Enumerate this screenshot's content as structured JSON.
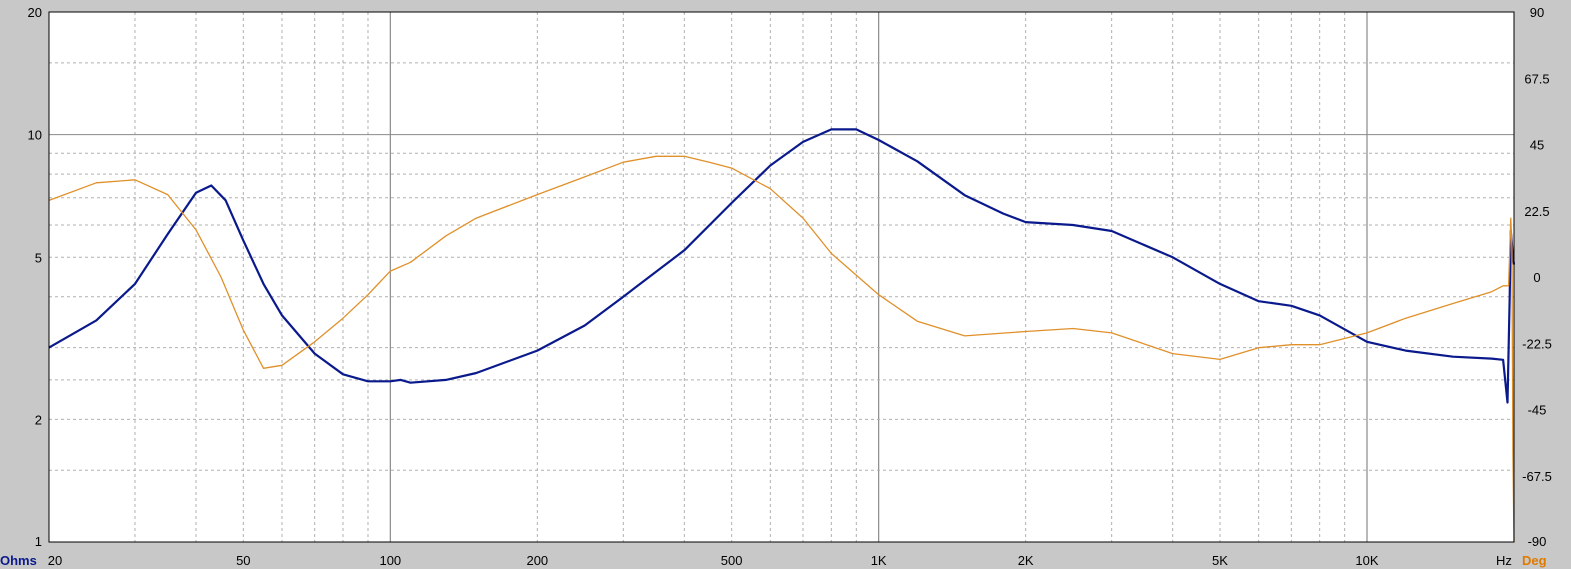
{
  "chart_data": {
    "type": "line",
    "x_scale": "log",
    "xlim": [
      20,
      20000
    ],
    "y_left_scale": "log",
    "y_left_lim": [
      1,
      20
    ],
    "y_right_lim": [
      -90,
      90
    ],
    "x_ticks": [
      {
        "value": 20,
        "label": "20"
      },
      {
        "value": 50,
        "label": "50"
      },
      {
        "value": 100,
        "label": "100"
      },
      {
        "value": 200,
        "label": "200"
      },
      {
        "value": 500,
        "label": "500"
      },
      {
        "value": 1000,
        "label": "1K"
      },
      {
        "value": 2000,
        "label": "2K"
      },
      {
        "value": 5000,
        "label": "5K"
      },
      {
        "value": 10000,
        "label": "10K"
      }
    ],
    "x_unit": "Hz",
    "y_left_ticks": [
      {
        "value": 20,
        "label": "20"
      },
      {
        "value": 10,
        "label": "10"
      },
      {
        "value": 5,
        "label": "5"
      },
      {
        "value": 2,
        "label": "2"
      },
      {
        "value": 1,
        "label": "1"
      }
    ],
    "y_left_unit": "Ohms",
    "y_right_ticks": [
      {
        "value": 90,
        "label": "90"
      },
      {
        "value": 67.5,
        "label": "67.5"
      },
      {
        "value": 45,
        "label": "45"
      },
      {
        "value": 22.5,
        "label": "22.5"
      },
      {
        "value": 0,
        "label": "0"
      },
      {
        "value": -22.5,
        "label": "-22.5"
      },
      {
        "value": -45,
        "label": "-45"
      },
      {
        "value": -67.5,
        "label": "-67.5"
      },
      {
        "value": -90,
        "label": "-90"
      }
    ],
    "y_right_unit": "Deg",
    "grid": true,
    "colors": {
      "impedance": "#0a1a8c",
      "phase": "#e0902a",
      "left_unit": "#0a1a8c",
      "right_unit": "#e07a00",
      "plot_bg": "#ffffff",
      "frame_bg": "#c8c8c8"
    },
    "series": [
      {
        "axis": "left",
        "color": "#0a1a8c",
        "points": [
          [
            20,
            3.0
          ],
          [
            25,
            3.5
          ],
          [
            30,
            4.3
          ],
          [
            35,
            5.7
          ],
          [
            40,
            7.2
          ],
          [
            43,
            7.5
          ],
          [
            46,
            6.9
          ],
          [
            50,
            5.5
          ],
          [
            55,
            4.3
          ],
          [
            60,
            3.6
          ],
          [
            70,
            2.9
          ],
          [
            80,
            2.58
          ],
          [
            90,
            2.48
          ],
          [
            100,
            2.48
          ],
          [
            105,
            2.5
          ],
          [
            110,
            2.46
          ],
          [
            130,
            2.5
          ],
          [
            150,
            2.6
          ],
          [
            200,
            2.95
          ],
          [
            250,
            3.4
          ],
          [
            300,
            4.0
          ],
          [
            400,
            5.2
          ],
          [
            500,
            6.8
          ],
          [
            600,
            8.4
          ],
          [
            700,
            9.6
          ],
          [
            800,
            10.3
          ],
          [
            900,
            10.3
          ],
          [
            1000,
            9.7
          ],
          [
            1200,
            8.6
          ],
          [
            1500,
            7.1
          ],
          [
            1800,
            6.4
          ],
          [
            2000,
            6.1
          ],
          [
            2500,
            6.0
          ],
          [
            3000,
            5.8
          ],
          [
            4000,
            5.0
          ],
          [
            5000,
            4.3
          ],
          [
            6000,
            3.9
          ],
          [
            7000,
            3.8
          ],
          [
            8000,
            3.6
          ],
          [
            10000,
            3.1
          ],
          [
            12000,
            2.95
          ],
          [
            15000,
            2.85
          ],
          [
            18000,
            2.82
          ],
          [
            19000,
            2.8
          ],
          [
            19400,
            2.2
          ],
          [
            19600,
            4.0
          ],
          [
            19700,
            5.8
          ],
          [
            19800,
            5.4
          ],
          [
            19900,
            5.0
          ],
          [
            20000,
            4.8
          ]
        ]
      },
      {
        "axis": "right",
        "color": "#e0902a",
        "points": [
          [
            20,
            26
          ],
          [
            25,
            32
          ],
          [
            30,
            33
          ],
          [
            35,
            28
          ],
          [
            40,
            16
          ],
          [
            45,
            0
          ],
          [
            50,
            -18
          ],
          [
            55,
            -31
          ],
          [
            60,
            -30
          ],
          [
            70,
            -22
          ],
          [
            80,
            -14
          ],
          [
            90,
            -6
          ],
          [
            100,
            2
          ],
          [
            110,
            5
          ],
          [
            130,
            14
          ],
          [
            150,
            20
          ],
          [
            200,
            28
          ],
          [
            250,
            34
          ],
          [
            300,
            39
          ],
          [
            350,
            41
          ],
          [
            400,
            41
          ],
          [
            450,
            39
          ],
          [
            500,
            37
          ],
          [
            600,
            30
          ],
          [
            700,
            20
          ],
          [
            800,
            8
          ],
          [
            1000,
            -6
          ],
          [
            1200,
            -15
          ],
          [
            1500,
            -20
          ],
          [
            2000,
            -18.5
          ],
          [
            2500,
            -17.5
          ],
          [
            3000,
            -19
          ],
          [
            4000,
            -26
          ],
          [
            5000,
            -28
          ],
          [
            6000,
            -24
          ],
          [
            7000,
            -23
          ],
          [
            8000,
            -23
          ],
          [
            10000,
            -19
          ],
          [
            12000,
            -14
          ],
          [
            15000,
            -9
          ],
          [
            18000,
            -5
          ],
          [
            19000,
            -3
          ],
          [
            19500,
            -3
          ],
          [
            19700,
            20
          ],
          [
            19800,
            10
          ],
          [
            19900,
            -60
          ],
          [
            20000,
            -90
          ]
        ]
      }
    ]
  }
}
